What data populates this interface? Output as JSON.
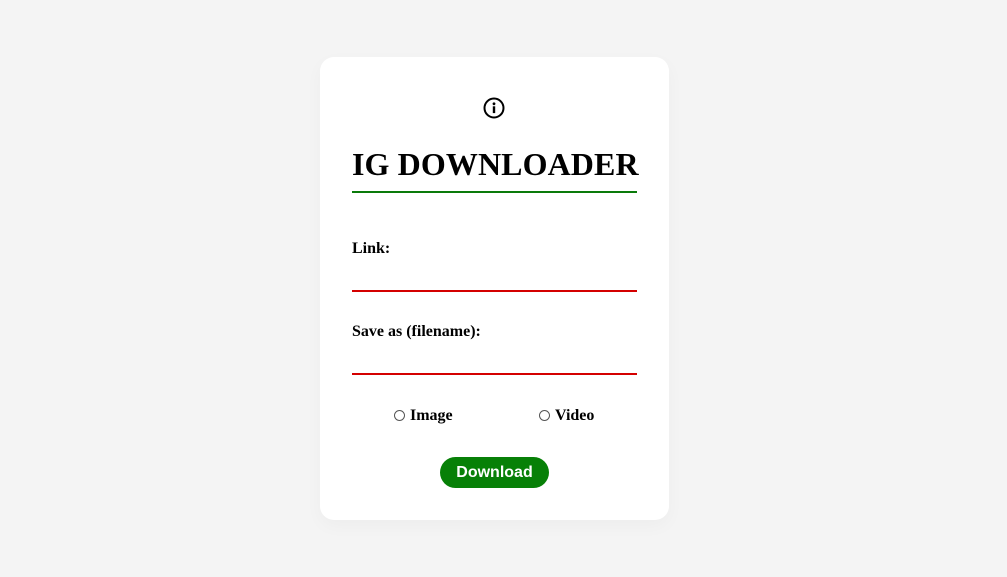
{
  "header": {
    "info_icon": "info-circle-icon",
    "title": "IG DOWNLOADER"
  },
  "form": {
    "link_label": "Link:",
    "link_value": "",
    "filename_label": "Save as (filename):",
    "filename_value": "",
    "media_options": [
      {
        "label": "Image",
        "selected": false
      },
      {
        "label": "Video",
        "selected": false
      }
    ],
    "download_label": "Download"
  },
  "colors": {
    "page_background": "#f4f4f4",
    "card_background": "#ffffff",
    "title_underline": "#0a7a0a",
    "input_underline": "#d40000",
    "download_button": "#078007",
    "download_text": "#ffffff"
  }
}
